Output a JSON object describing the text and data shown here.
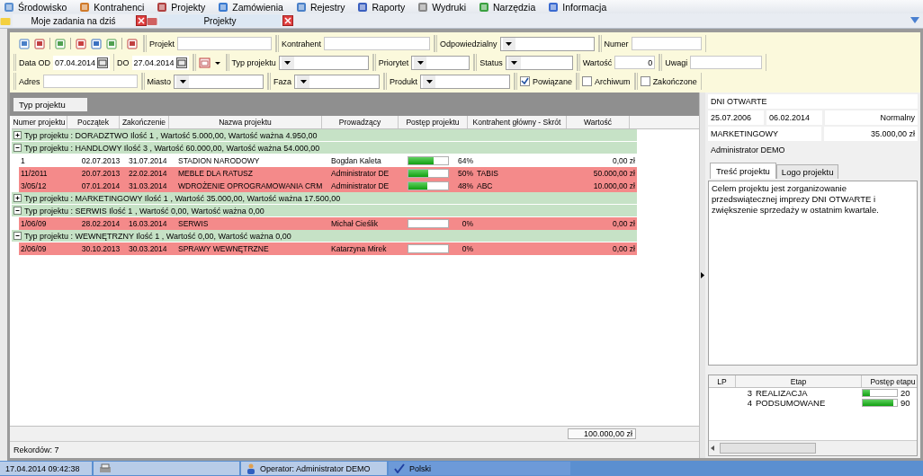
{
  "menu": [
    {
      "label": "Środowisko"
    },
    {
      "label": "Kontrahenci"
    },
    {
      "label": "Projekty"
    },
    {
      "label": "Zamówienia"
    },
    {
      "label": "Rejestry"
    },
    {
      "label": "Raporty"
    },
    {
      "label": "Wydruki"
    },
    {
      "label": "Narzędzia"
    },
    {
      "label": "Informacja"
    }
  ],
  "tabs": [
    {
      "label": "Moje zadania na dziś",
      "selected": false
    },
    {
      "label": "Projekty",
      "selected": true
    }
  ],
  "filters": [
    [
      {
        "kind": "text",
        "label": "Projekt"
      },
      {
        "kind": "text",
        "label": "Kontrahent"
      },
      {
        "kind": "combo",
        "label": "Odpowiedzialny"
      },
      {
        "kind": "text",
        "label": "Numer"
      }
    ],
    [
      {
        "kind": "date",
        "label": "Data OD",
        "value": "07.04.2014"
      },
      {
        "kind": "date",
        "label": "DO",
        "value": "27.04.2014"
      },
      {
        "kind": "calendar-menu"
      },
      {
        "kind": "combo",
        "label": "Typ projektu"
      },
      {
        "kind": "combo",
        "label": "Priorytet"
      },
      {
        "kind": "combo",
        "label": "Status"
      },
      {
        "kind": "number",
        "label": "Wartość",
        "value": "0"
      },
      {
        "kind": "text",
        "label": "Uwagi"
      }
    ],
    [
      {
        "kind": "text",
        "label": "Adres"
      },
      {
        "kind": "combo",
        "label": "Miasto"
      },
      {
        "kind": "combo",
        "label": "Faza"
      },
      {
        "kind": "combo",
        "label": "Produkt"
      },
      {
        "kind": "checkbox",
        "label": "Powiązane",
        "checked": true
      },
      {
        "kind": "checkbox",
        "label": "Archiwum",
        "checked": false
      },
      {
        "kind": "checkbox",
        "label": "Zakończone",
        "checked": false
      }
    ]
  ],
  "group_by": "Typ projektu",
  "table": {
    "columns": [
      "Numer projektu",
      "Początek",
      "Zakończenie",
      "Nazwa projektu",
      "Prowadzący",
      "Postęp projektu",
      "Kontrahent główny - Skrót",
      "Wartość"
    ],
    "groups": [
      {
        "label": "Typ projektu : DORADZTWO  Ilość 1 ,  Wartość 5.000,00,  Wartość ważna 4.950,00",
        "expanded": false
      },
      {
        "label": "Typ projektu : HANDLOWY  Ilość 3 ,  Wartość 60.000,00,  Wartość ważna 54.000,00",
        "expanded": true,
        "rows": [
          {
            "number": "1",
            "start": "02.07.2013",
            "end": "31.07.2014",
            "name": "STADION NARODOWY",
            "lead": "Bogdan Kaleta",
            "level": 0.64,
            "percent": "64%",
            "client": "",
            "value": "0,00 zł",
            "overdue": false
          },
          {
            "number": "11/2011",
            "start": "20.07.2013",
            "end": "22.02.2014",
            "name": "MEBLE DLA RATUSZ",
            "lead": "Administrator DE",
            "level": 0.5,
            "percent": "50%",
            "client": "TABIS",
            "value": "50.000,00 zł",
            "overdue": true
          },
          {
            "number": "3/05/12",
            "start": "07.01.2014",
            "end": "31.03.2014",
            "name": "WDROŻENIE OPROGRAMOWANIA CRM",
            "lead": "Administrator DE",
            "level": 0.48,
            "percent": "48%",
            "client": "ABC",
            "value": "10.000,00 zł",
            "overdue": true
          }
        ]
      },
      {
        "label": "Typ projektu : MARKETINGOWY  Ilość 1 ,  Wartość 35.000,00,  Wartość ważna 17.500,00",
        "expanded": false
      },
      {
        "label": "Typ projektu : SERWIS  Ilość 1 ,  Wartość 0,00,  Wartość ważna 0,00",
        "expanded": true,
        "rows": [
          {
            "number": "1/06/09",
            "start": "28.02.2014",
            "end": "16.03.2014",
            "name": "SERWIS",
            "lead": "Michał Cieślik",
            "level": 0,
            "percent": "0%",
            "client": "",
            "value": "0,00 zł",
            "overdue": true
          }
        ]
      },
      {
        "label": "Typ projektu : WEWNĘTRZNY  Ilość 1 ,  Wartość 0,00,  Wartość ważna 0,00",
        "expanded": true,
        "rows": [
          {
            "number": "2/06/09",
            "start": "30.10.2013",
            "end": "30.03.2014",
            "name": "SPRAWY WEWNĘTRZNE",
            "lead": "Katarzyna Mirek",
            "level": 0,
            "percent": "0%",
            "client": "",
            "value": "0,00 zł",
            "overdue": true
          }
        ]
      }
    ],
    "total": "100.000,00 zł"
  },
  "records": "Rekordów: 7",
  "details": {
    "title": "DNI OTWARTE",
    "start": "25.07.2006",
    "end": "06.02.2014",
    "priority": "Normalny",
    "type": "MARKETINGOWY",
    "value": "35.000,00 zł",
    "owner": "Administrator DEMO",
    "tabs": [
      {
        "label": "Treść projektu",
        "selected": true
      },
      {
        "label": "Logo projektu",
        "selected": false
      }
    ],
    "description": "Celem projektu jest zorganizowanie przedswiątecznej imprezy DNI OTWARTE i zwiększenie sprzedaży w ostatnim kwartale.",
    "stages": {
      "columns": [
        "LP",
        "Etap",
        "Postęp etapu"
      ],
      "rows": [
        {
          "lp": "3",
          "name": "REALIZACJA",
          "level": 0.2,
          "percent": "20"
        },
        {
          "lp": "4",
          "name": "PODSUMOWANE",
          "level": 0.9,
          "percent": "90"
        }
      ]
    }
  },
  "status_bar": {
    "time": "17.04.2014 09:42:38",
    "operator": "Operator: Administrator DEMO",
    "language": "Polski"
  }
}
